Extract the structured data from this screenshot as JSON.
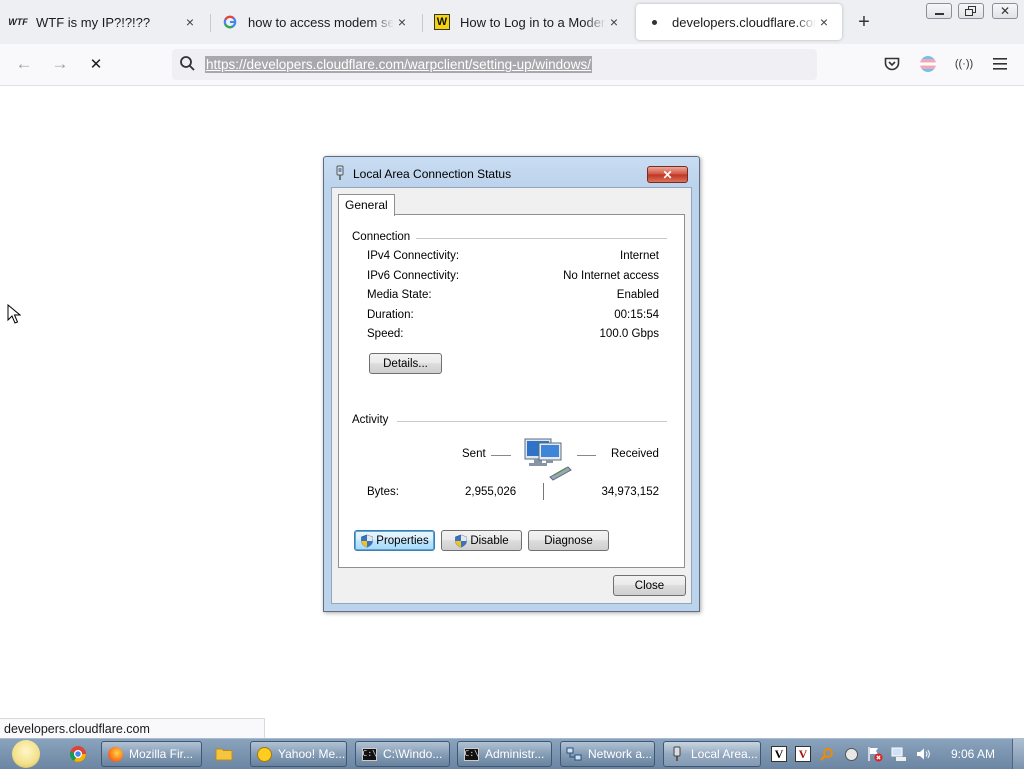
{
  "browser": {
    "tabs": [
      {
        "title": "WTF is my IP?!?!??",
        "favicon": "wtf-icon",
        "active": false
      },
      {
        "title": "how to access modem settings",
        "favicon": "google-icon",
        "active": false
      },
      {
        "title": "How to Log in to a Modem",
        "favicon": "wikihow-icon",
        "active": false
      },
      {
        "title": "developers.cloudflare.com/warpclient",
        "favicon": "loading-dot-icon",
        "active": true
      }
    ],
    "close_glyph": "×",
    "new_tab_glyph": "+",
    "url": "https://developers.cloudflare.com/warpclient/setting-up/windows/",
    "status_link": "developers.cloudflare.com"
  },
  "dialog": {
    "title": "Local Area Connection Status",
    "close_glyph": "✕",
    "tab": "General",
    "connection": {
      "header": "Connection",
      "rows": [
        {
          "label": "IPv4 Connectivity:",
          "value": "Internet"
        },
        {
          "label": "IPv6 Connectivity:",
          "value": "No Internet access"
        },
        {
          "label": "Media State:",
          "value": "Enabled"
        },
        {
          "label": "Duration:",
          "value": "00:15:54"
        },
        {
          "label": "Speed:",
          "value": "100.0 Gbps"
        }
      ],
      "details_button": "Details..."
    },
    "activity": {
      "header": "Activity",
      "sent_label": "Sent",
      "received_label": "Received",
      "bytes_label": "Bytes:",
      "bytes_sent": "2,955,026",
      "bytes_received": "34,973,152"
    },
    "buttons": {
      "properties": "Properties",
      "disable": "Disable",
      "diagnose": "Diagnose",
      "close": "Close"
    }
  },
  "taskbar": {
    "items": [
      {
        "label": "Mozilla Fir...",
        "icon": "firefox-icon"
      },
      {
        "label": "Yahoo! Me...",
        "icon": "yahoo-messenger-icon"
      },
      {
        "label": "C:\\Windo...",
        "icon": "cmd-icon"
      },
      {
        "label": "Administr...",
        "icon": "cmd-icon"
      },
      {
        "label": "Network a...",
        "icon": "network-icon"
      },
      {
        "label": "Local Area...",
        "icon": "network-adapter-icon"
      }
    ],
    "clock": "9:06 AM"
  },
  "colors": {
    "accent_blue": "#3c7fb1",
    "dialog_frame": "#bcd3ec",
    "taskbar": "#7690ad",
    "close_red": "#c0331f"
  }
}
